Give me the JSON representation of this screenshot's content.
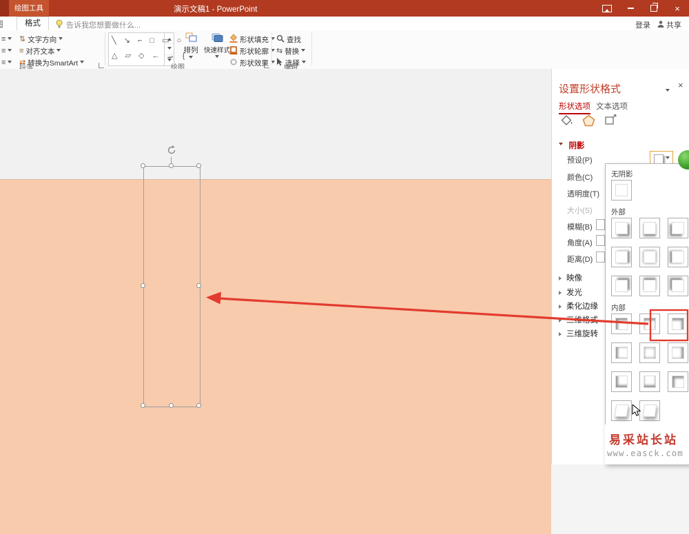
{
  "titlebar": {
    "context_group": "绘图工具",
    "title": "演示文稿1 - PowerPoint",
    "close_glyph": "×"
  },
  "tabrow": {
    "partial_tab": "图",
    "format_tab": "格式",
    "tell_me": "告诉我您想要做什么...",
    "sign_in": "登录",
    "share": "共享"
  },
  "ribbon": {
    "paragraph": {
      "text_direction": "文字方向",
      "align_text": "对齐文本",
      "smartart": "转换为SmartArt",
      "label": "段落"
    },
    "drawing": {
      "gallery_row1": "╲ ↘ ⌐ □ ▭ ○",
      "gallery_row2": "△ ▱ ◇ ← → {",
      "arrange": "排列",
      "quick_styles": "快速样式",
      "fill": "形状填充",
      "outline": "形状轮廓",
      "effects": "形状效果",
      "label": "绘图"
    },
    "editing": {
      "find": "查找",
      "replace": "替换",
      "select": "选择",
      "label": "编辑"
    }
  },
  "icons": {
    "text_direction": "⇅",
    "align_text": "≡",
    "smartart": "⇄",
    "replace": "⇆"
  },
  "panel": {
    "title": "设置形状格式",
    "close_glyph": "×",
    "tab_shape": "形状选项",
    "tab_text": "文本选项",
    "shadow": {
      "header": "阴影",
      "preset": "预设(P)",
      "color": "颜色(C)",
      "transparency": "透明度(T)",
      "size": "大小(S)",
      "blur": "模糊(B)",
      "angle": "角度(A)",
      "distance": "距离(D)"
    },
    "sections": [
      {
        "label": "映像"
      },
      {
        "label": "发光"
      },
      {
        "label": "柔化边缘"
      },
      {
        "label": "三维格式"
      },
      {
        "label": "三维旋转"
      }
    ]
  },
  "flyout": {
    "no_shadow": "无阴影",
    "outer": "外部",
    "inner": "内部"
  },
  "watermark": {
    "line1": "易采站长站",
    "line2": "www.easck.com"
  },
  "colors": {
    "titlebar": "#B13A21",
    "accent_red": "#C00000",
    "slide_fill": "#F8CBAD",
    "annotation_red": "#E23B2E"
  }
}
